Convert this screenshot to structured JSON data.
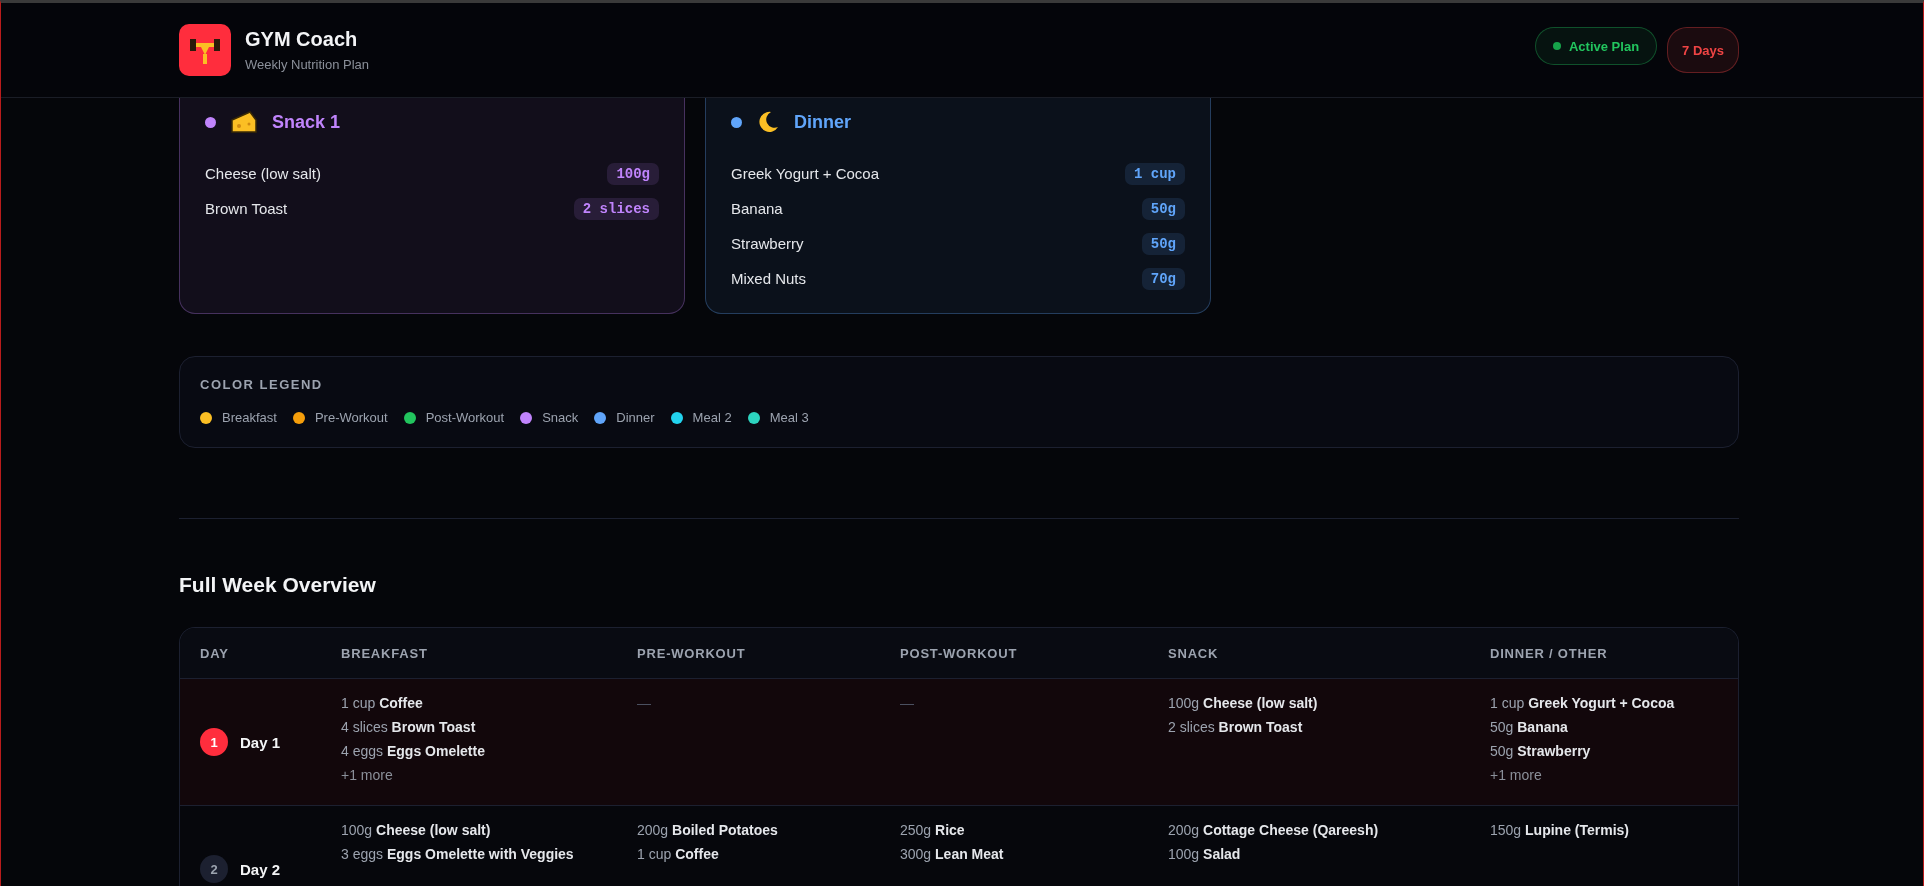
{
  "header": {
    "title": "GYM Coach",
    "subtitle": "Weekly Nutrition Plan",
    "badges": [
      {
        "label": "Active Plan",
        "kind": "status"
      },
      {
        "label": "7 Days",
        "kind": "count"
      }
    ]
  },
  "meal_cards": [
    {
      "kind": "snack",
      "title": "Snack 1",
      "color": "#c084fc",
      "items": [
        {
          "name": "Cheese (low salt)",
          "amount": "100g"
        },
        {
          "name": "Brown Toast",
          "amount": "2 slices"
        }
      ]
    },
    {
      "kind": "dinner",
      "title": "Dinner",
      "color": "#60a5fa",
      "items": [
        {
          "name": "Greek Yogurt + Cocoa",
          "amount": "1 cup"
        },
        {
          "name": "Banana",
          "amount": "50g"
        },
        {
          "name": "Strawberry",
          "amount": "50g"
        },
        {
          "name": "Mixed Nuts",
          "amount": "70g"
        }
      ]
    }
  ],
  "legend": {
    "title": "COLOR LEGEND",
    "items": [
      {
        "label": "Breakfast",
        "color": "#fbbf24"
      },
      {
        "label": "Pre-Workout",
        "color": "#f59e0b"
      },
      {
        "label": "Post-Workout",
        "color": "#22c55e"
      },
      {
        "label": "Snack",
        "color": "#c084fc"
      },
      {
        "label": "Dinner",
        "color": "#60a5fa"
      },
      {
        "label": "Meal 2",
        "color": "#22d3ee"
      },
      {
        "label": "Meal 3",
        "color": "#2dd4bf"
      }
    ]
  },
  "overview": {
    "title": "Full Week Overview",
    "columns": [
      "DAY",
      "BREAKFAST",
      "PRE-WORKOUT",
      "POST-WORKOUT",
      "SNACK",
      "DINNER / OTHER"
    ],
    "rows": [
      {
        "selected": true,
        "cells": [
          {
            "number": "1",
            "day": "Day 1"
          },
          {
            "items": [
              {
                "qty": "1 cup",
                "name": "Coffee"
              },
              {
                "qty": "4 slices",
                "name": "Brown Toast"
              },
              {
                "qty": "4 eggs",
                "name": "Eggs Omelette"
              }
            ],
            "more": "+1 more"
          },
          {
            "empty": "—"
          },
          {
            "empty": "—"
          },
          {
            "items": [
              {
                "qty": "100g",
                "name": "Cheese (low salt)"
              },
              {
                "qty": "2 slices",
                "name": "Brown Toast"
              }
            ]
          },
          {
            "items": [
              {
                "qty": "1 cup",
                "name": "Greek Yogurt + Cocoa"
              },
              {
                "qty": "50g",
                "name": "Banana"
              },
              {
                "qty": "50g",
                "name": "Strawberry"
              }
            ],
            "more": "+1 more"
          }
        ]
      },
      {
        "selected": false,
        "cells": [
          {
            "number": "2",
            "day": "Day 2"
          },
          {
            "items": [
              {
                "qty": "100g",
                "name": "Cheese (low salt)"
              },
              {
                "qty": "3 eggs",
                "name": "Eggs Omelette with Veggies"
              }
            ]
          },
          {
            "items": [
              {
                "qty": "200g",
                "name": "Boiled Potatoes"
              },
              {
                "qty": "1 cup",
                "name": "Coffee"
              }
            ]
          },
          {
            "items": [
              {
                "qty": "250g",
                "name": "Rice"
              },
              {
                "qty": "300g",
                "name": "Lean Meat"
              }
            ]
          },
          {
            "items": [
              {
                "qty": "200g",
                "name": "Cottage Cheese (Qareesh)"
              },
              {
                "qty": "100g",
                "name": "Salad"
              }
            ]
          },
          {
            "items": [
              {
                "qty": "150g",
                "name": "Lupine (Termis)"
              }
            ]
          }
        ]
      }
    ]
  }
}
